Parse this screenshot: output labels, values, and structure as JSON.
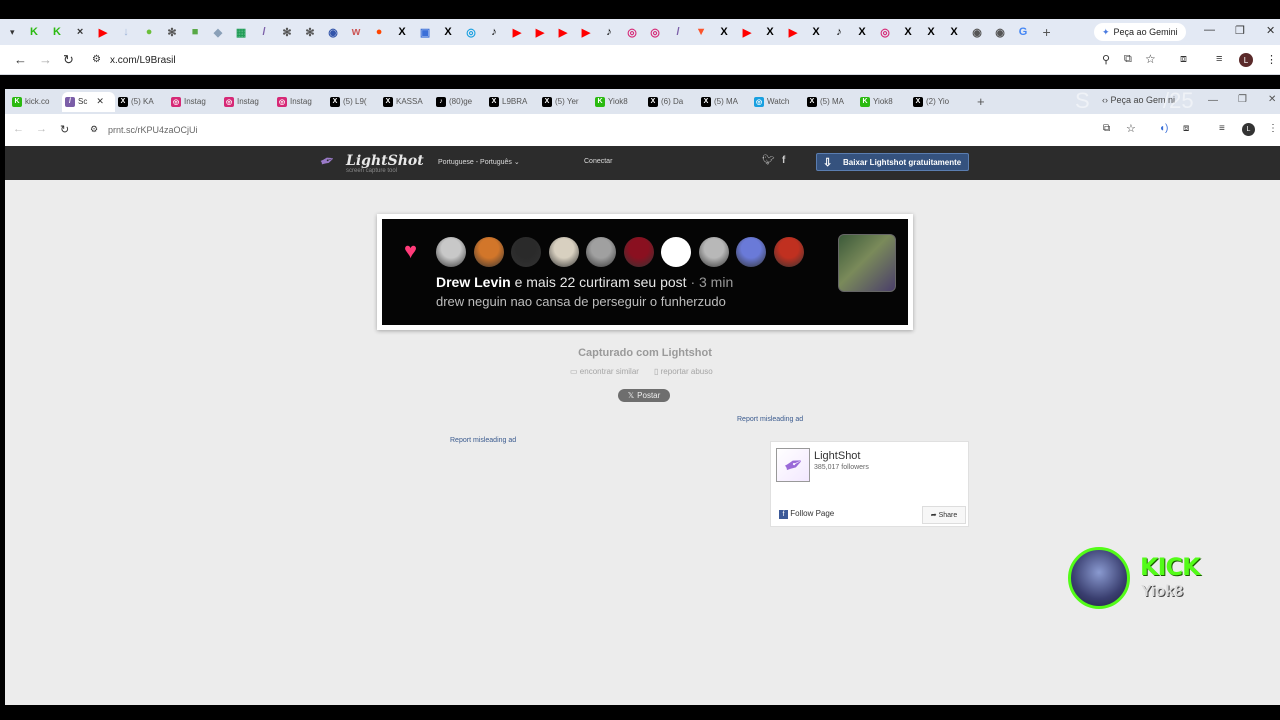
{
  "outer_browser": {
    "url": "x.com/L9Brasil",
    "gemini_label": "Peça ao Gemini",
    "tab_icons": [
      {
        "name": "kick-icon",
        "color": "#2bba11",
        "glyph": "K"
      },
      {
        "name": "kick-icon",
        "color": "#2bba11",
        "glyph": "K"
      },
      {
        "name": "close-icon",
        "color": "#ffffff",
        "glyph": "×"
      },
      {
        "name": "youtube-icon",
        "color": "#ff0000",
        "glyph": "▶"
      },
      {
        "name": "download-icon",
        "color": "#9fb5d8",
        "glyph": "↓"
      },
      {
        "name": "site-icon",
        "color": "#6bbf3a",
        "glyph": "●"
      },
      {
        "name": "openai-icon",
        "color": "#555555",
        "glyph": "✻"
      },
      {
        "name": "site-icon",
        "color": "#57a845",
        "glyph": "■"
      },
      {
        "name": "site-icon",
        "color": "#8aa0b8",
        "glyph": "◆"
      },
      {
        "name": "sheets-icon",
        "color": "#1f9d55",
        "glyph": "▦"
      },
      {
        "name": "lightshot-icon",
        "color": "#7b5ea8",
        "glyph": "/"
      },
      {
        "name": "openai-icon",
        "color": "#555555",
        "glyph": "✻"
      },
      {
        "name": "openai-icon",
        "color": "#555555",
        "glyph": "✻"
      },
      {
        "name": "site-icon",
        "color": "#3355aa",
        "glyph": "◉"
      },
      {
        "name": "site-icon",
        "color": "#cc5555",
        "glyph": "w"
      },
      {
        "name": "reddit-icon",
        "color": "#ff4500",
        "glyph": "●"
      },
      {
        "name": "x-icon",
        "color": "#000000",
        "glyph": "X"
      },
      {
        "name": "site-icon",
        "color": "#3a6fd8",
        "glyph": "▣"
      },
      {
        "name": "x-icon",
        "color": "#000000",
        "glyph": "X"
      },
      {
        "name": "site-icon",
        "color": "#19a0e0",
        "glyph": "◎"
      },
      {
        "name": "tiktok-icon",
        "color": "#000000",
        "glyph": "♪"
      },
      {
        "name": "youtube-icon",
        "color": "#ff0000",
        "glyph": "▶"
      },
      {
        "name": "youtube-icon",
        "color": "#ff0000",
        "glyph": "▶"
      },
      {
        "name": "youtube-icon",
        "color": "#ff0000",
        "glyph": "▶"
      },
      {
        "name": "youtube-icon",
        "color": "#ff0000",
        "glyph": "▶"
      },
      {
        "name": "tiktok-icon",
        "color": "#000000",
        "glyph": "♪"
      },
      {
        "name": "instagram-icon",
        "color": "#d62976",
        "glyph": "◎"
      },
      {
        "name": "instagram-icon",
        "color": "#d62976",
        "glyph": "◎"
      },
      {
        "name": "lightshot-icon",
        "color": "#7b5ea8",
        "glyph": "/"
      },
      {
        "name": "brave-icon",
        "color": "#fb542b",
        "glyph": "▼"
      },
      {
        "name": "x-icon",
        "color": "#000000",
        "glyph": "X"
      },
      {
        "name": "youtube-icon",
        "color": "#ff0000",
        "glyph": "▶"
      },
      {
        "name": "x-icon",
        "color": "#000000",
        "glyph": "X"
      },
      {
        "name": "youtube-icon",
        "color": "#ff0000",
        "glyph": "▶"
      },
      {
        "name": "x-icon",
        "color": "#000000",
        "glyph": "X"
      },
      {
        "name": "tiktok-icon",
        "color": "#000000",
        "glyph": "♪"
      },
      {
        "name": "x-icon",
        "color": "#000000",
        "glyph": "X"
      },
      {
        "name": "instagram-icon",
        "color": "#d62976",
        "glyph": "◎"
      },
      {
        "name": "x-icon",
        "color": "#000000",
        "glyph": "X"
      },
      {
        "name": "x-icon",
        "color": "#000000",
        "glyph": "X"
      },
      {
        "name": "x-icon",
        "color": "#000000",
        "glyph": "X"
      },
      {
        "name": "chrome-icon",
        "color": "#555555",
        "glyph": "◉"
      },
      {
        "name": "chrome-icon",
        "color": "#555555",
        "glyph": "◉"
      },
      {
        "name": "google-icon",
        "color": "#4285f4",
        "glyph": "G"
      }
    ]
  },
  "inner_browser": {
    "url": "prnt.sc/rKPU4zaOCjUi",
    "gemini_label": "Peça ao Gem ni",
    "tabs": [
      {
        "label": "kick.co",
        "icon": "kick-icon",
        "color": "#2bba11",
        "glyph": "K"
      },
      {
        "label": "Sc",
        "icon": "lightshot-icon",
        "color": "#7b5ea8",
        "glyph": "/",
        "active": true
      },
      {
        "label": "(5) KA",
        "icon": "x-icon",
        "color": "#000000",
        "glyph": "X"
      },
      {
        "label": "Instag",
        "icon": "instagram-icon",
        "color": "#d62976",
        "glyph": "◎"
      },
      {
        "label": "Instag",
        "icon": "instagram-icon",
        "color": "#d62976",
        "glyph": "◎"
      },
      {
        "label": "Instag",
        "icon": "instagram-icon",
        "color": "#d62976",
        "glyph": "◎"
      },
      {
        "label": "(5) L9(",
        "icon": "x-icon",
        "color": "#000000",
        "glyph": "X"
      },
      {
        "label": "KASSA",
        "icon": "x-icon",
        "color": "#000000",
        "glyph": "X"
      },
      {
        "label": "(80)ge",
        "icon": "tiktok-icon",
        "color": "#000000",
        "glyph": "♪"
      },
      {
        "label": "L9BRA",
        "icon": "x-icon",
        "color": "#000000",
        "glyph": "X"
      },
      {
        "label": "(5) Yer",
        "icon": "x-icon",
        "color": "#000000",
        "glyph": "X"
      },
      {
        "label": "Yiok8",
        "icon": "kick-icon",
        "color": "#2bba11",
        "glyph": "K"
      },
      {
        "label": "(6) Da",
        "icon": "x-icon",
        "color": "#000000",
        "glyph": "X"
      },
      {
        "label": "(5) MA",
        "icon": "x-icon",
        "color": "#000000",
        "glyph": "X"
      },
      {
        "label": "Watch",
        "icon": "site-icon",
        "color": "#19a0e0",
        "glyph": "◎"
      },
      {
        "label": "(5) MA",
        "icon": "x-icon",
        "color": "#000000",
        "glyph": "X"
      },
      {
        "label": "Yiok8",
        "icon": "kick-icon",
        "color": "#2bba11",
        "glyph": "K"
      },
      {
        "label": "(2) Yio",
        "icon": "x-icon",
        "color": "#000000",
        "glyph": "X"
      }
    ]
  },
  "lightshot": {
    "logo": "LightShot",
    "logo_sub": "screen capture tool",
    "language": "Portuguese - Português",
    "login": "Conectar",
    "download_button": "Baixar Lightshot gratuitamente",
    "captured_label": "Capturado com Lightshot",
    "find_similar": "encontrar similar",
    "report_abuse": "reportar abuso",
    "post_button": "Postar",
    "report_ad_1": "Report misleading ad",
    "report_ad_2": "Report misleading ad",
    "fb": {
      "name": "LightShot",
      "followers": "385,017 followers",
      "follow": "Follow Page",
      "share": "Share"
    }
  },
  "screenshot_content": {
    "user": "Drew Levin",
    "action": " e mais 22 curtiram seu post",
    "time": " · 3 min",
    "message": "drew neguin nao cansa de perseguir o funherzudo",
    "avatar_colors": [
      "#c8c8c8",
      "#d2762a",
      "#2a2a2a",
      "#d8d0c0",
      "#a0a0a0",
      "#8a1020",
      "#ffffff",
      "#b8b8b8",
      "#6a7ad8",
      "#c03020"
    ]
  },
  "overlay": {
    "kick_label": "KICK",
    "kick_user": "Yiok8"
  }
}
